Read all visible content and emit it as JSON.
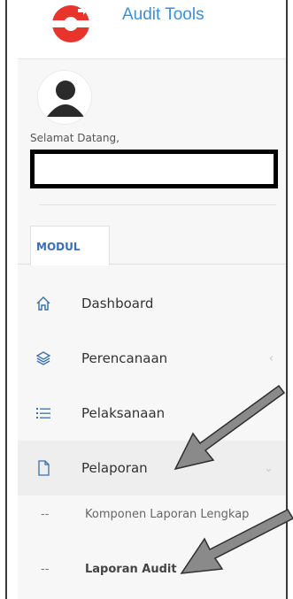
{
  "header": {
    "app_title": "Audit Tools"
  },
  "user": {
    "welcome": "Selamat Datang,",
    "name": ""
  },
  "tabs": [
    {
      "label": "MODUL"
    }
  ],
  "menu": {
    "dashboard": "Dashboard",
    "perencanaan": "Perencanaan",
    "pelaksanaan": "Pelaksanaan",
    "pelaporan": "Pelaporan"
  },
  "submenu": {
    "komponen": "Komponen Laporan Lengkap",
    "laporan_audit": "Laporan Audit",
    "dash": "--"
  },
  "colors": {
    "accent": "#3d8fd6",
    "logo_red": "#e8352c",
    "tab_text": "#3b6fb1",
    "arrow_fill": "#8a8a8a"
  },
  "icons": {
    "dashboard": "home-icon",
    "perencanaan": "layers-icon",
    "pelaksanaan": "list-icon",
    "pelaporan": "document-icon"
  }
}
